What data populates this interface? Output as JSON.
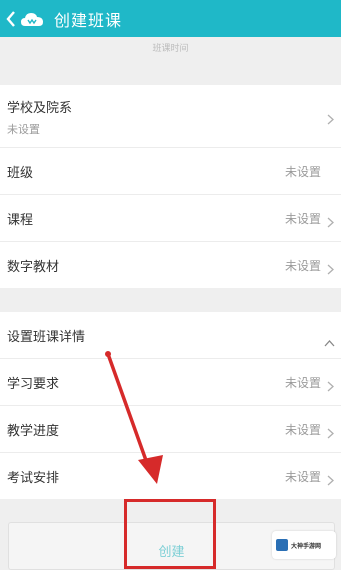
{
  "header": {
    "title": "创建班课"
  },
  "hint": "班课时间",
  "school_group": [
    {
      "label": "学校及院系",
      "sub": "未设置"
    },
    {
      "label": "班级",
      "value": "未设置"
    },
    {
      "label": "课程",
      "value": "未设置"
    },
    {
      "label": "数字教材",
      "value": "未设置"
    }
  ],
  "details_group": {
    "header": "设置班课详情",
    "rows": [
      {
        "label": "学习要求",
        "value": "未设置"
      },
      {
        "label": "教学进度",
        "value": "未设置"
      },
      {
        "label": "考试安排",
        "value": "未设置"
      }
    ]
  },
  "create_button": "创建",
  "watermark": "大神手游网",
  "colors": {
    "accent": "#1fb8c8",
    "annotation": "#d62a2a"
  }
}
